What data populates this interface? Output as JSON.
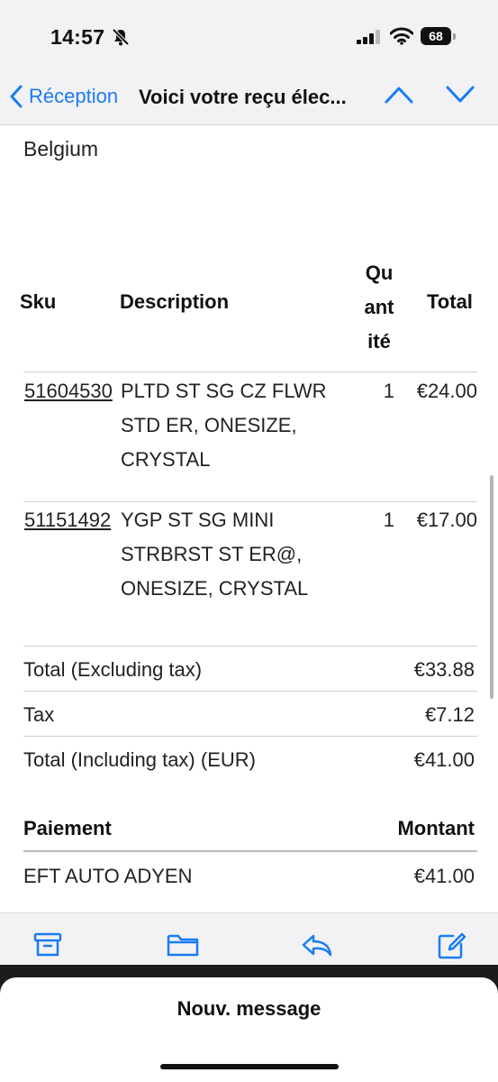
{
  "status_bar": {
    "time": "14:57",
    "battery": "68"
  },
  "nav": {
    "back_label": "Réception",
    "title": "Voici votre reçu élec..."
  },
  "address": {
    "country": "Belgium"
  },
  "items_table": {
    "headers": {
      "sku": "Sku",
      "description": "Description",
      "quantity_lines": [
        "Qu",
        "ant",
        "ité"
      ],
      "total": "Total"
    },
    "rows": [
      {
        "sku": "51604530",
        "description_lines": [
          "PLTD ST SG CZ FLWR",
          "STD ER, ONESIZE,",
          "CRYSTAL"
        ],
        "quantity": "1",
        "total": "€24.00"
      },
      {
        "sku": "51151492",
        "description_lines": [
          "YGP ST SG MINI",
          "STRBRST ST ER@,",
          "ONESIZE, CRYSTAL"
        ],
        "quantity": "1",
        "total": "€17.00"
      }
    ]
  },
  "totals": [
    {
      "label": "Total (Excluding tax)",
      "value": "€33.88"
    },
    {
      "label": "Tax",
      "value": "€7.12"
    },
    {
      "label": "Total (Including tax) (EUR)",
      "value": "€41.00"
    }
  ],
  "payment": {
    "header_method": "Paiement",
    "header_amount": "Montant",
    "rows": [
      {
        "method": "EFT AUTO ADYEN",
        "amount": "€41.00"
      }
    ]
  },
  "toolbar": {
    "icons": [
      "archive-icon",
      "folder-icon",
      "reply-icon",
      "compose-icon"
    ]
  },
  "sheet": {
    "title": "Nouv. message"
  },
  "colors": {
    "accent": "#1a7cf5",
    "bar_bg": "#f2f2f4"
  }
}
